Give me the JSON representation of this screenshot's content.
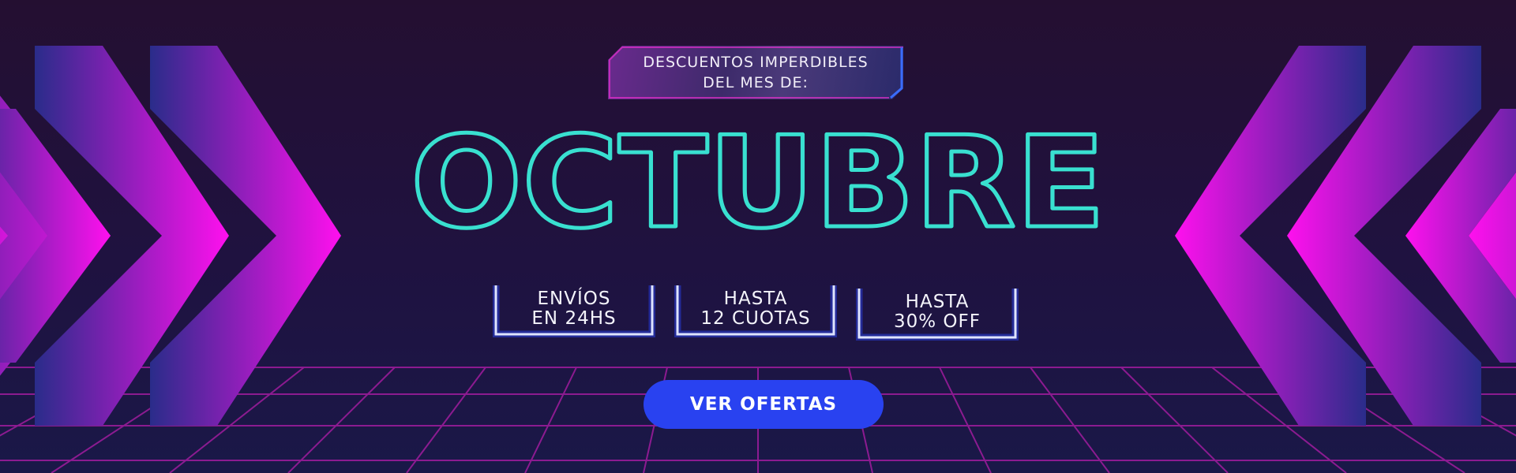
{
  "promo": {
    "tagline": [
      "DESCUENTOS IMPERDIBLES",
      "DEL MES DE:"
    ],
    "month": "OCTUBRE",
    "features": [
      {
        "line1": "ENVÍOS",
        "line2": "EN 24HS"
      },
      {
        "line1": "HASTA",
        "line2": "12 CUOTAS"
      },
      {
        "line1": "HASTA",
        "line2": "30% OFF"
      }
    ],
    "cta_label": "VER OFERTAS"
  },
  "colors": {
    "headline": "#39e0d0",
    "accent_pink": "#ff14f0",
    "accent_blue": "#2942f0",
    "grid": "#a01c9e"
  },
  "icons": [
    "chevron-right-icon",
    "chevron-left-icon"
  ]
}
